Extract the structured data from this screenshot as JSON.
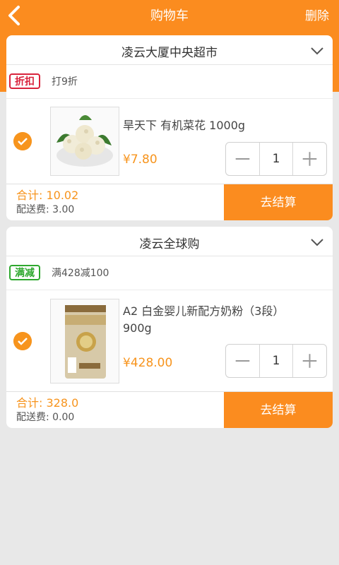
{
  "header": {
    "title": "购物车",
    "delete_label": "删除",
    "back_icon": "chevron-left-icon"
  },
  "colors": {
    "accent": "#fb8c1f",
    "discount_tag": "#d9233c",
    "fullcut_tag": "#2ea82e"
  },
  "stores": [
    {
      "name": "凌云大厦中央超市",
      "promo_tag": "折扣",
      "promo_text": "打9折",
      "item": {
        "name": "旱天下 有机菜花 1000g",
        "name_line2": "",
        "price": "¥7.80",
        "quantity": "1",
        "image": "cauliflower"
      },
      "subtotal": "合计: 10.02",
      "shipping": "配送费: 3.00",
      "checkout_label": "去结算"
    },
    {
      "name": "凌云全球购",
      "promo_tag": "满减",
      "promo_text": "满428减100",
      "item": {
        "name": "A2 白金婴儿新配方奶粉（3段）",
        "name_line2": "900g",
        "price": "¥428.00",
        "quantity": "1",
        "image": "milk-powder-can"
      },
      "subtotal": "合计: 328.0",
      "shipping": "配送费: 0.00",
      "checkout_label": "去结算"
    }
  ]
}
